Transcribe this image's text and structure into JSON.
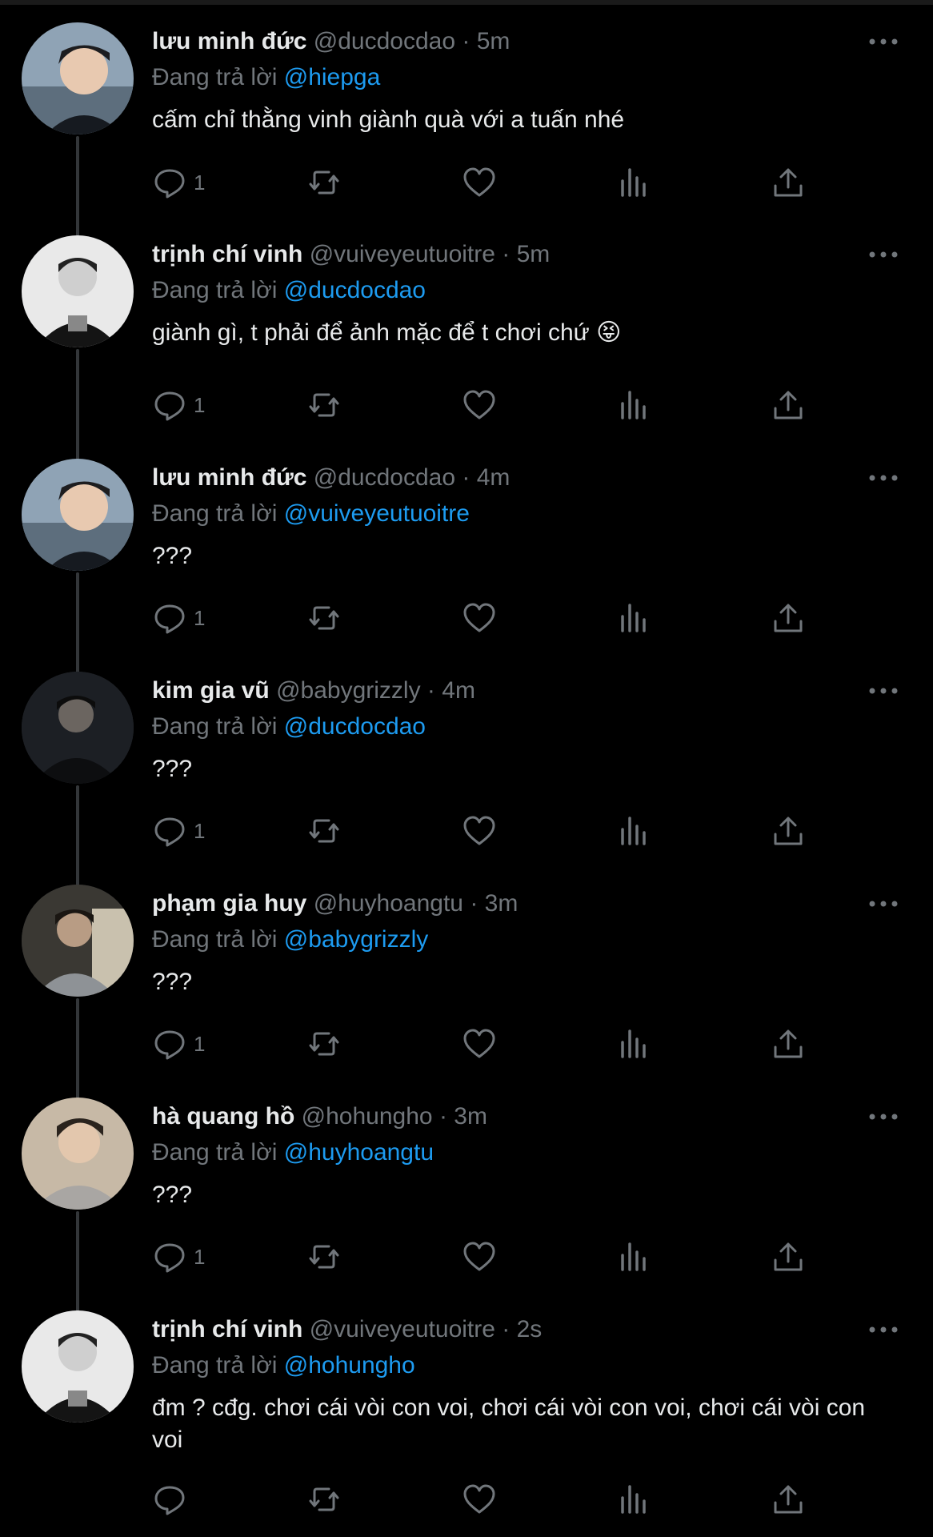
{
  "reply_prefix": "Đang trả lời",
  "tweets": [
    {
      "name": "lưu minh đức",
      "handle": "@ducdocdao",
      "sep": "·",
      "time": "5m",
      "reply_to": "@hiepga",
      "text": "cấm chỉ thằng vinh giành quà với a tuấn nhé",
      "reply_count": "1"
    },
    {
      "name": "trịnh chí vinh",
      "handle": "@vuiveyeutuoitre",
      "sep": "·",
      "time": "5m",
      "reply_to": "@ducdocdao",
      "text": "giành gì, t phải để ảnh mặc để t chơi chứ 😝",
      "reply_count": "1"
    },
    {
      "name": "lưu minh đức",
      "handle": "@ducdocdao",
      "sep": "·",
      "time": "4m",
      "reply_to": "@vuiveyeutuoitre",
      "text": "???",
      "reply_count": "1"
    },
    {
      "name": "kim gia vũ",
      "handle": "@babygrizzly",
      "sep": "·",
      "time": "4m",
      "reply_to": "@ducdocdao",
      "text": "???",
      "reply_count": "1"
    },
    {
      "name": "phạm gia huy",
      "handle": "@huyhoangtu",
      "sep": "·",
      "time": "3m",
      "reply_to": "@babygrizzly",
      "text": "???",
      "reply_count": "1"
    },
    {
      "name": "hà quang hồ",
      "handle": "@hohungho",
      "sep": "·",
      "time": "3m",
      "reply_to": "@huyhoangtu",
      "text": "???",
      "reply_count": "1"
    },
    {
      "name": "trịnh chí vinh",
      "handle": "@vuiveyeutuoitre",
      "sep": "·",
      "time": "2s",
      "reply_to": "@hohungho",
      "text": "đm ? cđg. chơi cái vòi con voi, chơi cái vòi con voi, chơi cái vòi con voi",
      "reply_count": ""
    }
  ],
  "icons": {
    "reply": "comment-bubble-icon",
    "retweet": "retweet-icon",
    "like": "heart-icon",
    "views": "bar-chart-icon",
    "share": "share-upload-icon",
    "more": "more-dots-icon"
  },
  "colors": {
    "background": "#000000",
    "text": "#e7e9ea",
    "muted": "#71767b",
    "mention": "#1d9bf0",
    "thread_line": "#333639"
  }
}
